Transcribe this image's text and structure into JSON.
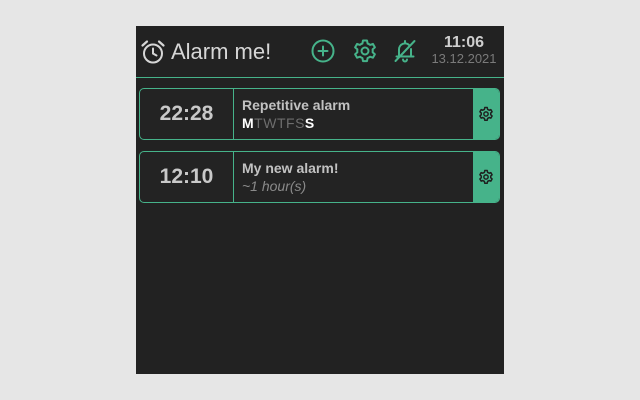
{
  "app": {
    "title": "Alarm me!",
    "accent_color": "#46b38a",
    "background_color": "#222222"
  },
  "header": {
    "logo_icon": "alarm-clock-icon",
    "add_icon": "plus-circle-icon",
    "settings_icon": "gear-icon",
    "mute_icon": "bell-off-icon",
    "clock": {
      "time": "11:06",
      "date": "13.12.2021"
    }
  },
  "alarms": [
    {
      "time": "22:28",
      "title": "Repetitive alarm",
      "days": [
        {
          "letter": "M",
          "active": true
        },
        {
          "letter": "T",
          "active": false
        },
        {
          "letter": "W",
          "active": false
        },
        {
          "letter": "T",
          "active": false
        },
        {
          "letter": "F",
          "active": false
        },
        {
          "letter": "S",
          "active": false
        },
        {
          "letter": "S",
          "active": true
        }
      ],
      "settings_icon": "gear-icon"
    },
    {
      "time": "12:10",
      "title": "My new alarm!",
      "subtitle": "~1 hour(s)",
      "settings_icon": "gear-icon"
    }
  ]
}
